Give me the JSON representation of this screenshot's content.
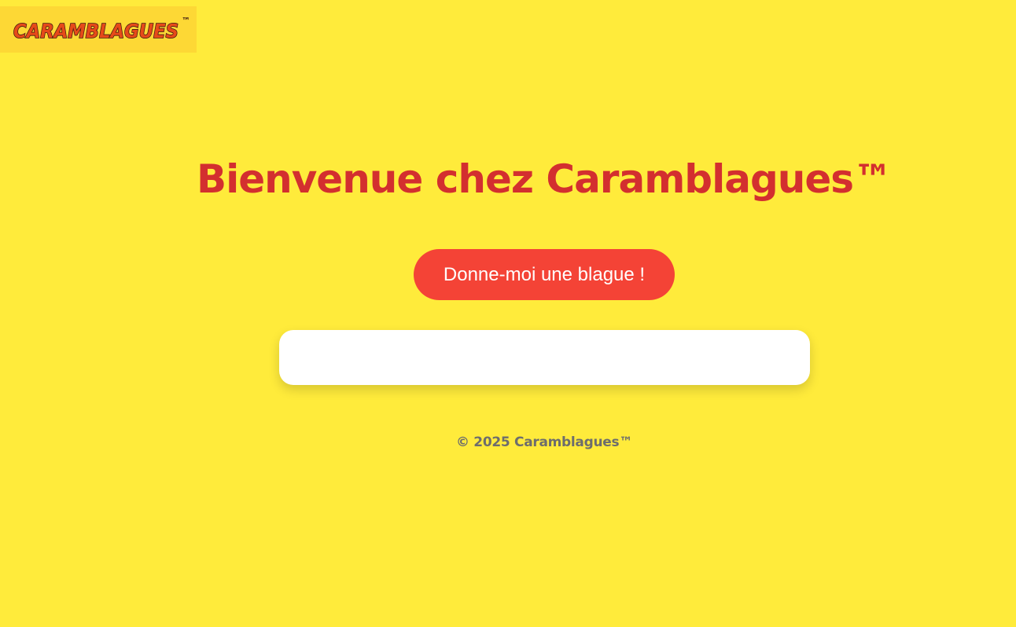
{
  "header": {
    "logo_text": "CARAMBLAGUES",
    "logo_tm": "™"
  },
  "main": {
    "title": "Bienvenue chez Caramblagues™",
    "joke_button_label": "Donne-moi une blague !",
    "joke_text": ""
  },
  "footer": {
    "copyright": "© 2025 Caramblagues™"
  },
  "colors": {
    "background": "#ffeb3b",
    "logo_box": "#fdd835",
    "title_red": "#d32f2f",
    "button_red": "#f44336",
    "footer_gray": "#6d6d6d"
  }
}
